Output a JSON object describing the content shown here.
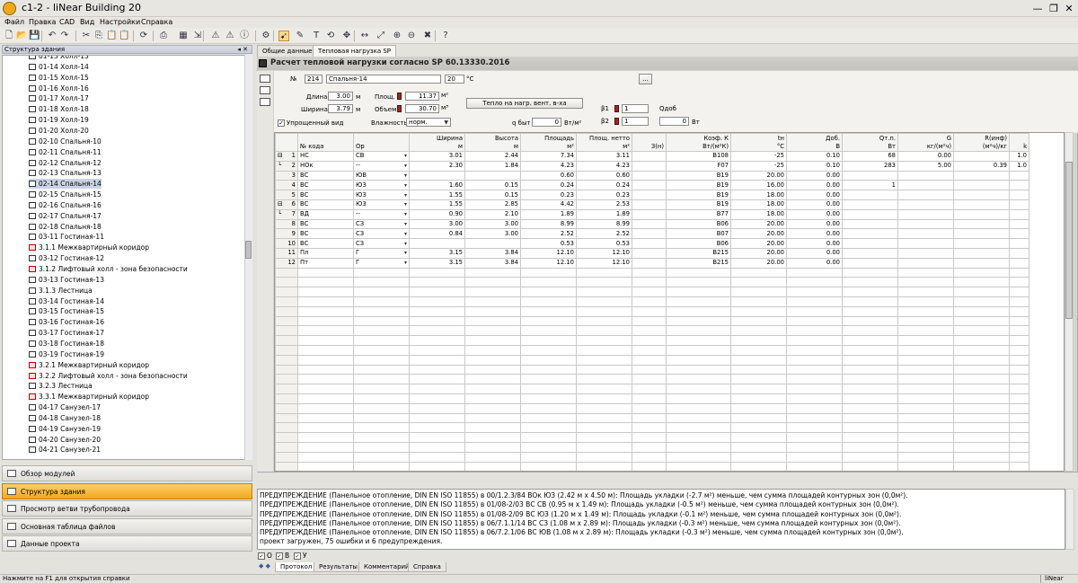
{
  "app": {
    "title": "c1-2 - liNear Building 20"
  },
  "window_controls": {
    "minimize": "—",
    "restore": "❐",
    "close": "✕"
  },
  "menu": [
    "Файл",
    "Правка",
    "CAD",
    "Вид",
    "Настройки",
    "Справка"
  ],
  "toolbar": {
    "icons": [
      "new-file-icon",
      "open-folder-icon",
      "save-icon",
      "undo-icon",
      "redo-icon",
      "cut-icon",
      "copy-icon",
      "paste-icon",
      "paste-special-icon",
      "refresh-icon",
      "print-icon",
      "calculate-icon",
      "import-icon",
      "warning-icon",
      "warning-list-icon",
      "info-icon",
      "settings-icon",
      "pointer-icon",
      "pen-icon",
      "text-icon",
      "rotate-icon",
      "move-icon",
      "dimension-icon",
      "zoom-fit-icon",
      "zoom-in-icon",
      "zoom-out-icon",
      "delete-icon",
      "help-icon"
    ],
    "active": "pointer-icon"
  },
  "tree": {
    "header": "Структура здания",
    "header_controls": "◂ ✕",
    "selected_index": 12,
    "items": [
      {
        "label": "01-13 Холл-13",
        "icon": "room-icon"
      },
      {
        "label": "01-14 Холл-14",
        "icon": "room-icon"
      },
      {
        "label": "01-15 Холл-15",
        "icon": "room-icon"
      },
      {
        "label": "01-16 Холл-16",
        "icon": "room-icon"
      },
      {
        "label": "01-17 Холл-17",
        "icon": "room-icon"
      },
      {
        "label": "01-18 Холл-18",
        "icon": "room-icon"
      },
      {
        "label": "01-19 Холл-19",
        "icon": "room-icon"
      },
      {
        "label": "01-20 Холл-20",
        "icon": "room-icon"
      },
      {
        "label": "02-10 Спальня-10",
        "icon": "room-icon"
      },
      {
        "label": "02-11 Спальня-11",
        "icon": "room-icon"
      },
      {
        "label": "02-12 Спальня-12",
        "icon": "room-icon"
      },
      {
        "label": "02-13 Спальня-13",
        "icon": "room-icon"
      },
      {
        "label": "02-14 Спальня-14",
        "icon": "room-icon"
      },
      {
        "label": "02-15 Спальня-15",
        "icon": "room-icon"
      },
      {
        "label": "02-16 Спальня-16",
        "icon": "room-icon"
      },
      {
        "label": "02-17 Спальня-17",
        "icon": "room-icon"
      },
      {
        "label": "02-18 Спальня-18",
        "icon": "room-icon"
      },
      {
        "label": "03-11 Гостиная-11",
        "icon": "room-icon"
      },
      {
        "label": "3.1.1 Межквартирный коридор",
        "icon": "room-warning-icon"
      },
      {
        "label": "03-12 Гостиная-12",
        "icon": "room-icon"
      },
      {
        "label": "3.1.2 Лифтовый холл - зона безопасности",
        "icon": "room-warning-icon"
      },
      {
        "label": "03-13 Гостиная-13",
        "icon": "room-icon"
      },
      {
        "label": "3.1.3 Лестница",
        "icon": "room-icon"
      },
      {
        "label": "03-14 Гостиная-14",
        "icon": "room-icon"
      },
      {
        "label": "03-15 Гостиная-15",
        "icon": "room-icon"
      },
      {
        "label": "03-16 Гостиная-16",
        "icon": "room-icon"
      },
      {
        "label": "03-17 Гостиная-17",
        "icon": "room-icon"
      },
      {
        "label": "03-18 Гостиная-18",
        "icon": "room-icon"
      },
      {
        "label": "03-19 Гостиная-19",
        "icon": "room-icon"
      },
      {
        "label": "3.2.1 Межквартирный коридор",
        "icon": "room-warning-icon"
      },
      {
        "label": "3.2.2 Лифтовый холл - зона безопасности",
        "icon": "room-warning-icon"
      },
      {
        "label": "3.2.3 Лестница",
        "icon": "room-icon"
      },
      {
        "label": "3.3.1 Межквартирный коридор",
        "icon": "room-warning-icon"
      },
      {
        "label": "04-17 Санузел-17",
        "icon": "room-icon"
      },
      {
        "label": "04-18 Санузел-18",
        "icon": "room-icon"
      },
      {
        "label": "04-19 Санузел-19",
        "icon": "room-icon"
      },
      {
        "label": "04-20 Санузел-20",
        "icon": "room-icon"
      },
      {
        "label": "04-21 Санузел-21",
        "icon": "room-icon"
      }
    ]
  },
  "nav": {
    "active_index": 1,
    "items": [
      "Обзор модулей",
      "Структура здания",
      "Просмотр ветви трубопровода",
      "Основная таблица файлов",
      "Данные проекта"
    ]
  },
  "tabs": [
    "Общие данные",
    "Тепловая нагрузка SP"
  ],
  "active_tab": 1,
  "panel": {
    "title": "Расчет тепловой нагрузки согласно SP 60.13330.2016"
  },
  "form": {
    "no_label": "№",
    "no_value": "214",
    "room_name": "Спальня-14",
    "temp_value": "20",
    "temp_unit": "°C",
    "browse_button": "...",
    "length_label": "Длина",
    "length_value": "3.00",
    "length_unit": "м",
    "width_label": "Ширина",
    "width_value": "3.79",
    "width_unit": "м",
    "area_label": "Площ.",
    "area_value": "11.37",
    "area_unit": "м²",
    "volume_label": "Объем",
    "volume_value": "30.70",
    "volume_unit": "м³",
    "vent_button": "Тепло на нагр. вент. в-ха",
    "b1_label": "β1",
    "b1_value": "1",
    "b2_label": "β2",
    "b2_value": "1",
    "qadd_label": "Qдоб",
    "qadd_value": "0",
    "qadd_unit": "Вт",
    "simplified_label": "Упрощенный вид",
    "simplified_checked": "✓",
    "humidity_label": "Влажность",
    "humidity_value": "норм.",
    "qbyt_label": "q быт",
    "qbyt_value": "0",
    "qbyt_unit": "Вт/м²"
  },
  "grid": {
    "columns": [
      {
        "label": "",
        "unit": ""
      },
      {
        "label": "№ кода",
        "unit": ""
      },
      {
        "label": "Ор",
        "unit": ""
      },
      {
        "label": "Ширина",
        "unit": "м"
      },
      {
        "label": "Высота",
        "unit": "м"
      },
      {
        "label": "Площадь",
        "unit": "м²"
      },
      {
        "label": "Площ. нетто",
        "unit": "м²"
      },
      {
        "label": "З(н)",
        "unit": ""
      },
      {
        "label": "Коэф. К",
        "unit": "Вт/(м²К)"
      },
      {
        "label": "tн",
        "unit": "°C"
      },
      {
        "label": "Доб.",
        "unit": "В"
      },
      {
        "label": "Qт.п.",
        "unit": "Вт"
      },
      {
        "label": "G",
        "unit": "кг/(м²ч)"
      },
      {
        "label": "R(инф)",
        "unit": "(м²ч)/кг"
      },
      {
        "label": "k",
        "unit": ""
      }
    ],
    "rows": [
      {
        "expander": "⊟",
        "n": "1",
        "code": "НС",
        "or": "СВ",
        "w": "3.01",
        "h": "2.44",
        "a": "7.34",
        "an": "3.11",
        "z": "",
        "k": "B108",
        "tn": "-25",
        "add": "0.10",
        "q": "68",
        "g": "0.00",
        "r": "",
        "kk": "1.0"
      },
      {
        "expander": "└",
        "n": "2",
        "code": "НОк",
        "or": "--",
        "w": "2.30",
        "h": "1.84",
        "a": "4.23",
        "an": "4.23",
        "z": "",
        "k": "F07",
        "tn": "-25",
        "add": "0.10",
        "q": "283",
        "g": "5.00",
        "r": "0.39",
        "kk": "1.0"
      },
      {
        "expander": "",
        "n": "3",
        "code": "ВС",
        "or": "ЮВ",
        "w": "",
        "h": "",
        "a": "0.60",
        "an": "0.60",
        "z": "",
        "k": "B19",
        "tn": "20.00",
        "add": "0.00",
        "q": "",
        "g": "",
        "r": "",
        "kk": ""
      },
      {
        "expander": "",
        "n": "4",
        "code": "ВС",
        "or": "ЮЗ",
        "w": "1.60",
        "h": "0.15",
        "a": "0.24",
        "an": "0.24",
        "z": "",
        "k": "B19",
        "tn": "16.00",
        "add": "0.00",
        "q": "1",
        "g": "",
        "r": "",
        "kk": ""
      },
      {
        "expander": "",
        "n": "5",
        "code": "ВС",
        "or": "ЮЗ",
        "w": "1.55",
        "h": "0.15",
        "a": "0.23",
        "an": "0.23",
        "z": "",
        "k": "B19",
        "tn": "18.00",
        "add": "0.00",
        "q": "",
        "g": "",
        "r": "",
        "kk": ""
      },
      {
        "expander": "⊟",
        "n": "6",
        "code": "ВС",
        "or": "ЮЗ",
        "w": "1.55",
        "h": "2.85",
        "a": "4.42",
        "an": "2.53",
        "z": "",
        "k": "B19",
        "tn": "18.00",
        "add": "0.00",
        "q": "",
        "g": "",
        "r": "",
        "kk": ""
      },
      {
        "expander": "└",
        "n": "7",
        "code": "ВД",
        "or": "--",
        "w": "0.90",
        "h": "2.10",
        "a": "1.89",
        "an": "1.89",
        "z": "",
        "k": "B77",
        "tn": "18.00",
        "add": "0.00",
        "q": "",
        "g": "",
        "r": "",
        "kk": ""
      },
      {
        "expander": "",
        "n": "8",
        "code": "ВС",
        "or": "СЗ",
        "w": "3.00",
        "h": "3.00",
        "a": "8.99",
        "an": "8.99",
        "z": "",
        "k": "B06",
        "tn": "20.00",
        "add": "0.00",
        "q": "",
        "g": "",
        "r": "",
        "kk": ""
      },
      {
        "expander": "",
        "n": "9",
        "code": "ВС",
        "or": "СЗ",
        "w": "0.84",
        "h": "3.00",
        "a": "2.52",
        "an": "2.52",
        "z": "",
        "k": "B07",
        "tn": "20.00",
        "add": "0.00",
        "q": "",
        "g": "",
        "r": "",
        "kk": ""
      },
      {
        "expander": "",
        "n": "10",
        "code": "ВС",
        "or": "СЗ",
        "w": "",
        "h": "",
        "a": "0.53",
        "an": "0.53",
        "z": "",
        "k": "B06",
        "tn": "20.00",
        "add": "0.00",
        "q": "",
        "g": "",
        "r": "",
        "kk": ""
      },
      {
        "expander": "",
        "n": "11",
        "code": "Пл",
        "or": "Г",
        "w": "3.15",
        "h": "3.84",
        "a": "12.10",
        "an": "12.10",
        "z": "",
        "k": "B215",
        "tn": "20.00",
        "add": "0.00",
        "q": "",
        "g": "",
        "r": "",
        "kk": ""
      },
      {
        "expander": "",
        "n": "12",
        "code": "Пт",
        "or": "Г",
        "w": "3.15",
        "h": "3.84",
        "a": "12.10",
        "an": "12.10",
        "z": "",
        "k": "B215",
        "tn": "20.00",
        "add": "0.00",
        "q": "",
        "g": "",
        "r": "",
        "kk": ""
      }
    ],
    "dropdown_cols": [
      "or"
    ],
    "empty_rows": 23
  },
  "log": {
    "lines": [
      "ПРЕДУПРЕЖДЕНИЕ (Панельное отопление, DIN EN ISO 11855) в 00/1.2.3/84 ВОк ЮЗ (2.42 м x 4.50 м): Площадь укладки (-2.7 м²) меньше, чем сумма площадей контурных зон (0,0м²).",
      "ПРЕДУПРЕЖДЕНИЕ (Панельное отопление, DIN EN ISO 11855) в 01/08-2/03 ВС СВ (0.95 м x 1.49 м): Площадь укладки (-0.5 м²) меньше, чем сумма площадей контурных зон (0,0м²).",
      "ПРЕДУПРЕЖДЕНИЕ (Панельное отопление, DIN EN ISO 11855) в 01/08-2/09 ВС ЮЗ (1.20 м x 1.49 м): Площадь укладки (-0.1 м²) меньше, чем сумма площадей контурных зон (0,0м²).",
      "ПРЕДУПРЕЖДЕНИЕ (Панельное отопление, DIN EN ISO 11855) в 06/7.1.1/14 ВС СЗ (1.08 м x 2.89 м): Площадь укладки (-0.3 м²) меньше, чем сумма площадей контурных зон (0,0м²).",
      "ПРЕДУПРЕЖДЕНИЕ (Панельное отопление, DIN EN ISO 11855) в 06/7.2.1/06 ВС ЮВ (1.08 м x 2.89 м): Площадь укладки (-0.3 м²) меньше, чем сумма площадей контурных зон (0,0м²).",
      "проект загружен, 75 ошибки и 6 предупреждения."
    ]
  },
  "log_filter": [
    {
      "label": "О",
      "checked": "✓"
    },
    {
      "label": "В",
      "checked": "✓"
    },
    {
      "label": "У",
      "checked": "✓"
    }
  ],
  "bottom_tabs": [
    "Протокол",
    "Результаты",
    "Комментарий",
    "Справка"
  ],
  "bottom_tabs_active": 0,
  "bottom_nav": "◆ ◆",
  "status": {
    "left": "Нажмите на F1 для открытия справки",
    "right": "liNear"
  }
}
